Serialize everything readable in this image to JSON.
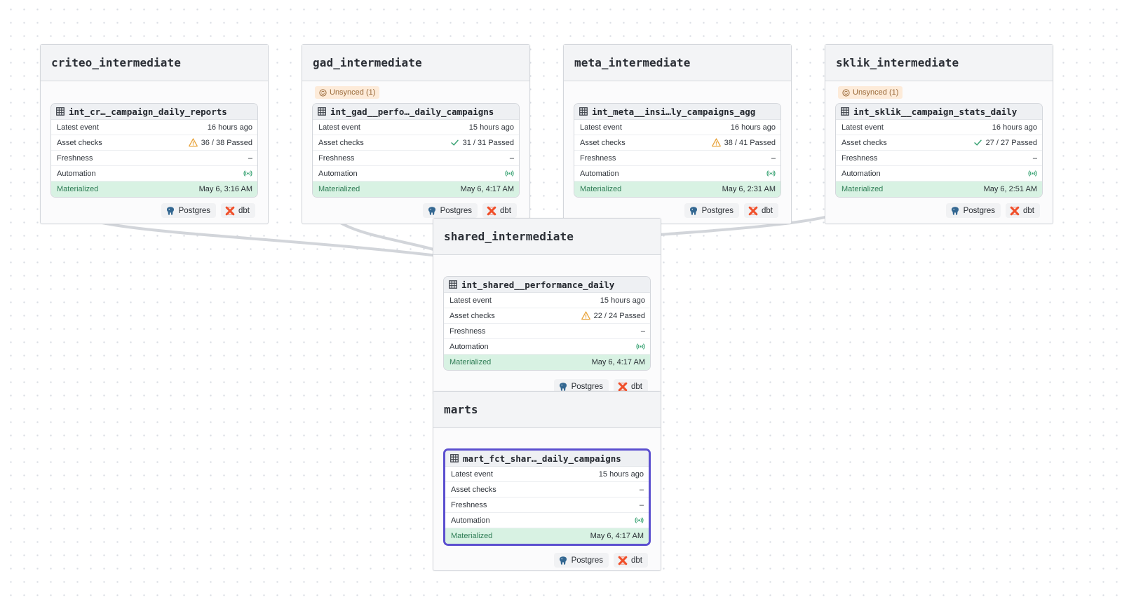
{
  "colors": {
    "selected_border": "#5b4fcf",
    "materialized_bg": "#d8f2e3",
    "materialized_text": "#2e7d55",
    "warning": "#e8a33a",
    "check_pass": "#3aa374",
    "automation": "#3aa374",
    "unsynced_bg": "#fdebd9",
    "dbt": "#f04f2a",
    "postgres": "#336791"
  },
  "labels": {
    "latest_event": "Latest event",
    "asset_checks": "Asset checks",
    "freshness": "Freshness",
    "automation": "Automation",
    "materialized": "Materialized"
  },
  "tags": {
    "postgres": "Postgres",
    "dbt": "dbt"
  },
  "icons": {
    "asset": "table-icon",
    "warning": "warning-triangle-icon",
    "passed": "checkmark-icon",
    "automation": "sensor-broadcast-icon",
    "unsynced": "unsynced-icon",
    "postgres": "postgres-elephant-icon",
    "dbt": "dbt-icon"
  },
  "groups": [
    {
      "name": "criteo_intermediate",
      "unsynced": null,
      "asset": {
        "name": "int_cr…_campaign_daily_reports",
        "latest_event": "16 hours ago",
        "asset_checks": "36 / 38 Passed",
        "checks_status": "warning",
        "freshness": "–",
        "materialized": "May 6, 3:16 AM",
        "selected": false
      }
    },
    {
      "name": "gad_intermediate",
      "unsynced": "Unsynced (1)",
      "asset": {
        "name": "int_gad__perfo…_daily_campaigns",
        "latest_event": "15 hours ago",
        "asset_checks": "31 / 31 Passed",
        "checks_status": "passed",
        "freshness": "–",
        "materialized": "May 6, 4:17 AM",
        "selected": false
      }
    },
    {
      "name": "meta_intermediate",
      "unsynced": null,
      "asset": {
        "name": "int_meta__insi…ly_campaigns_agg",
        "latest_event": "16 hours ago",
        "asset_checks": "38 / 41 Passed",
        "checks_status": "warning",
        "freshness": "–",
        "materialized": "May 6, 2:31 AM",
        "selected": false
      }
    },
    {
      "name": "sklik_intermediate",
      "unsynced": "Unsynced (1)",
      "asset": {
        "name": "int_sklik__campaign_stats_daily",
        "latest_event": "16 hours ago",
        "asset_checks": "27 / 27 Passed",
        "checks_status": "passed",
        "freshness": "–",
        "materialized": "May 6, 2:51 AM",
        "selected": false
      }
    },
    {
      "name": "shared_intermediate",
      "unsynced": null,
      "asset": {
        "name": "int_shared__performance_daily",
        "latest_event": "15 hours ago",
        "asset_checks": "22 / 24 Passed",
        "checks_status": "warning",
        "freshness": "–",
        "materialized": "May 6, 4:17 AM",
        "selected": false
      }
    },
    {
      "name": "marts",
      "unsynced": null,
      "asset": {
        "name": "mart_fct_shar…_daily_campaigns",
        "latest_event": "15 hours ago",
        "asset_checks": "–",
        "checks_status": "none",
        "freshness": "–",
        "materialized": "May 6, 4:17 AM",
        "selected": true
      }
    }
  ]
}
